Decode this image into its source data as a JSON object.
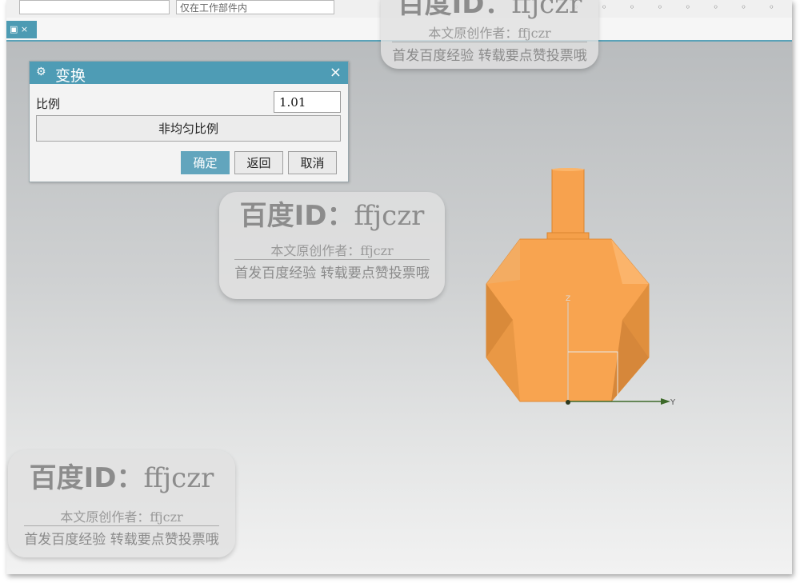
{
  "toolbar": {
    "field_left": "",
    "field_right": "仅在工作部件内"
  },
  "tab": {
    "icon": "part-icon",
    "close": "×"
  },
  "dialog": {
    "title": "变换",
    "close_symbol": "×",
    "scale_label": "比例",
    "scale_value": "1.01",
    "nonuniform_label": "非均匀比例",
    "ok_label": "确定",
    "back_label": "返回",
    "cancel_label": "取消"
  },
  "axes": {
    "y_label": "Y",
    "z_label": "Z"
  },
  "watermark": {
    "brand": "百度ID：",
    "user": "ffjczr",
    "author_line": "本文原创作者：ffjczr",
    "promo_line": "首发百度经验 转载要点赞投票哦"
  },
  "colors": {
    "title_bar": "#4e9cb5",
    "model_orange": "#f7a24e",
    "accent_button": "#62a5bd"
  }
}
